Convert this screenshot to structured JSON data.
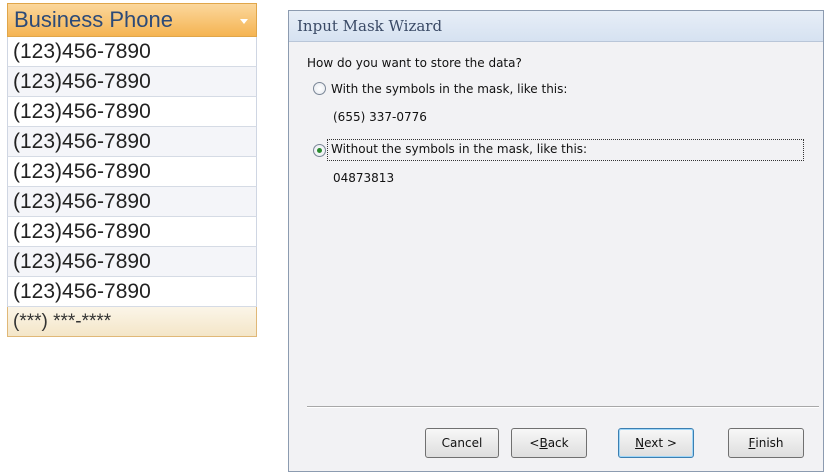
{
  "datasheet": {
    "column_header": "Business Phone",
    "rows": [
      "(123)456-7890",
      "(123)456-7890",
      "(123)456-7890",
      "(123)456-7890",
      "(123)456-7890",
      "(123)456-7890",
      "(123)456-7890",
      "(123)456-7890",
      "(123)456-7890"
    ],
    "new_row_mask": "(***) ***-****"
  },
  "wizard": {
    "title": "Input Mask Wizard",
    "question": "How do you want to store the data?",
    "options": [
      {
        "label": "With the symbols in the mask, like this:",
        "example": "(655) 337-0776",
        "selected": false
      },
      {
        "label": "Without the symbols in the mask, like this:",
        "example": "04873813",
        "selected": true
      }
    ],
    "buttons": {
      "cancel": "Cancel",
      "back_prefix": "< ",
      "back_hotkey": "B",
      "back_rest": "ack",
      "next_hotkey": "N",
      "next_rest": "ext >",
      "finish_hotkey": "F",
      "finish_rest": "inish"
    }
  }
}
